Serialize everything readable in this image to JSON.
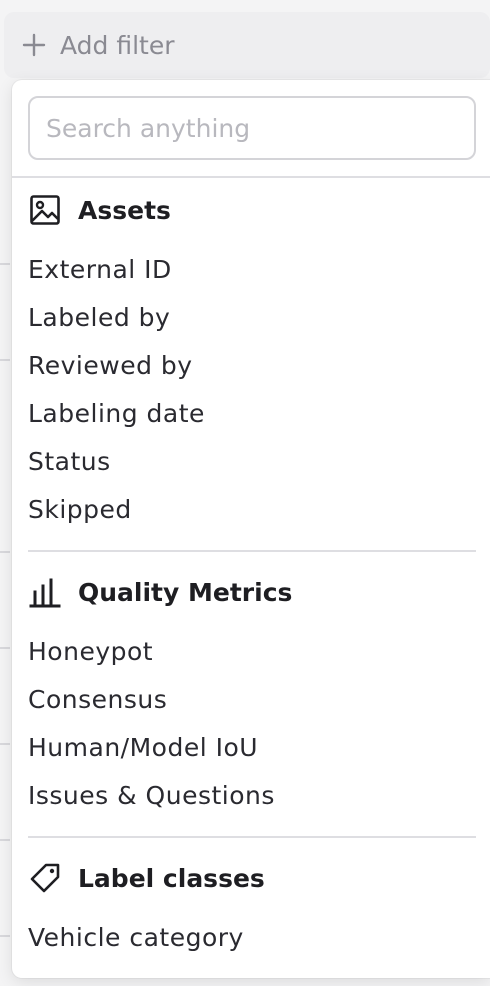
{
  "toolbar": {
    "add_filter_label": "Add filter"
  },
  "search": {
    "placeholder": "Search anything",
    "value": ""
  },
  "sections": [
    {
      "title": "Assets",
      "icon": "image-icon",
      "items": [
        "External ID",
        "Labeled by",
        "Reviewed by",
        "Labeling date",
        "Status",
        "Skipped"
      ]
    },
    {
      "title": "Quality Metrics",
      "icon": "bar-chart-icon",
      "items": [
        "Honeypot",
        "Consensus",
        "Human/Model IoU",
        "Issues & Questions"
      ]
    },
    {
      "title": "Label classes",
      "icon": "tag-icon",
      "items": [
        "Vehicle category"
      ]
    }
  ]
}
